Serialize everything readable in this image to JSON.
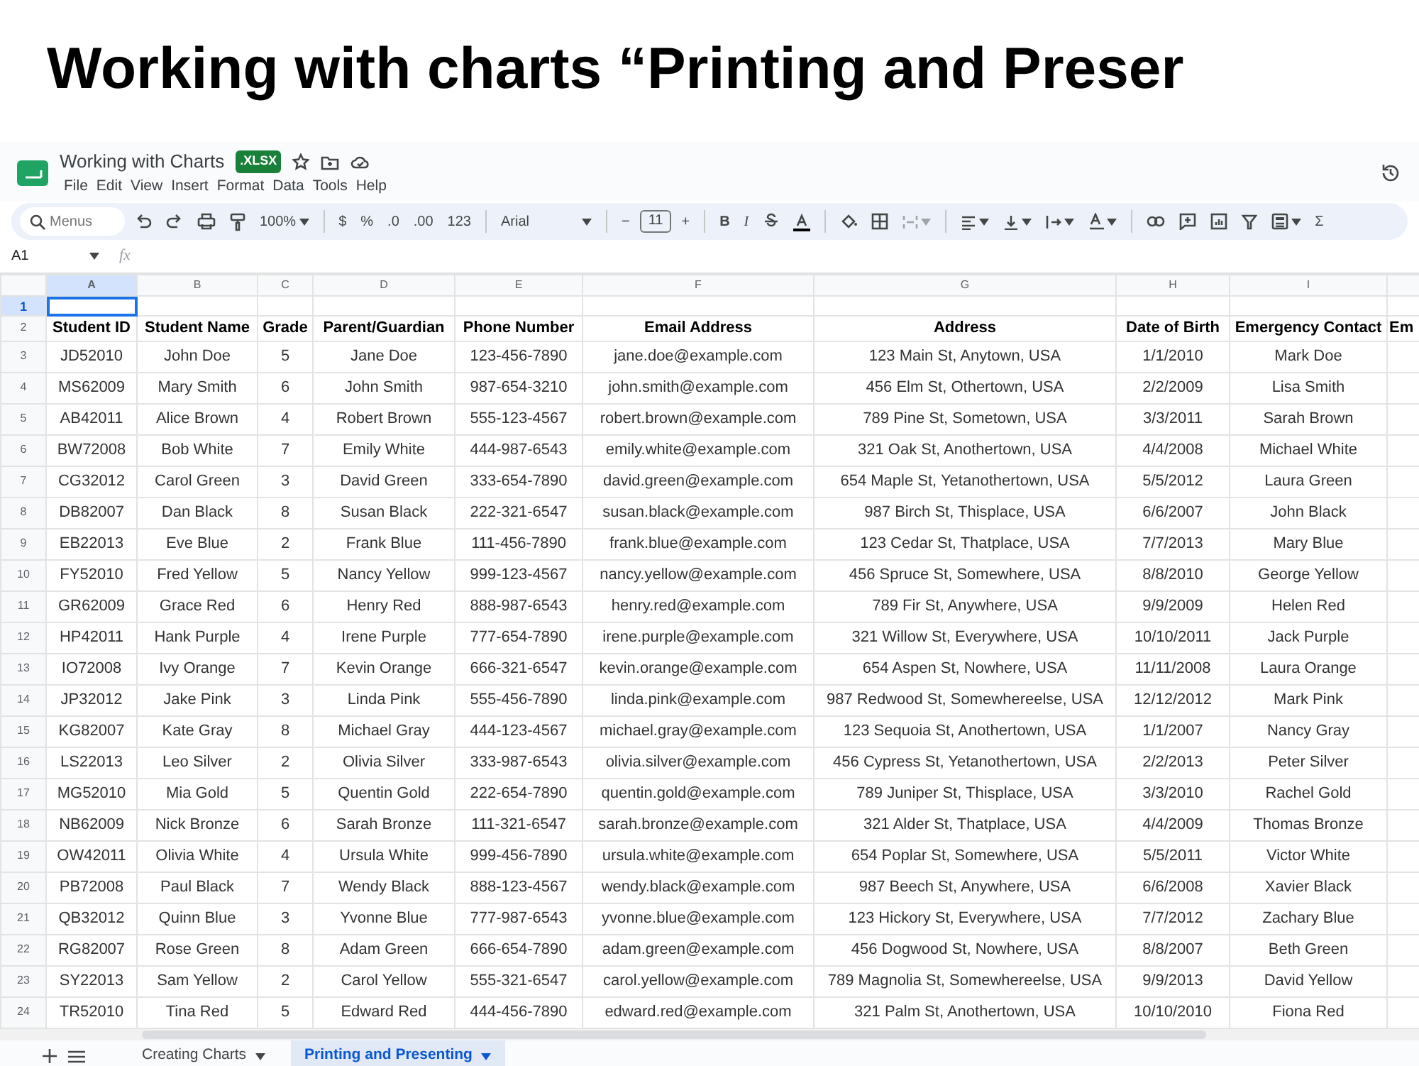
{
  "heading": "Working with charts “Printing and Preser",
  "doc": {
    "title": "Working with Charts",
    "badge": ".XLSX",
    "menus": [
      "File",
      "Edit",
      "View",
      "Insert",
      "Format",
      "Data",
      "Tools",
      "Help"
    ]
  },
  "toolbar": {
    "search_placeholder": "Menus",
    "zoom": "100%",
    "currency": "$",
    "percent": "%",
    "decrease_decimals": ".0",
    "increase_decimals": ".00",
    "number_format": "123",
    "font": "Arial",
    "minus": "−",
    "font_size": "11",
    "plus": "+",
    "bold": "B",
    "italic": "I",
    "sum": "Σ"
  },
  "name_box": "A1",
  "formula_label": "fx",
  "sheet": {
    "columns": [
      {
        "letter": "A",
        "selected": true
      },
      {
        "letter": "B",
        "selected": false
      },
      {
        "letter": "C",
        "selected": false
      },
      {
        "letter": "D",
        "selected": false
      },
      {
        "letter": "E",
        "selected": false
      },
      {
        "letter": "F",
        "selected": false
      },
      {
        "letter": "G",
        "selected": false
      },
      {
        "letter": "H",
        "selected": false
      },
      {
        "letter": "I",
        "selected": false
      }
    ],
    "rows": [
      {
        "num": "1",
        "selected": true
      },
      {
        "num": "2",
        "selected": false,
        "kind": "header",
        "cells": [
          "Student ID",
          "Student Name",
          "Grade",
          "Parent/Guardian",
          "Phone Number",
          "Email Address",
          "Address",
          "Date of Birth",
          "Emergency Contact",
          "Em"
        ]
      },
      {
        "num": "3",
        "selected": false,
        "cells": [
          "JD52010",
          "John Doe",
          "5",
          "Jane Doe",
          "123-456-7890",
          "jane.doe@example.com",
          "123 Main St, Anytown, USA",
          "1/1/2010",
          "Mark Doe"
        ]
      },
      {
        "num": "4",
        "selected": false,
        "cells": [
          "MS62009",
          "Mary Smith",
          "6",
          "John Smith",
          "987-654-3210",
          "john.smith@example.com",
          "456 Elm St, Othertown, USA",
          "2/2/2009",
          "Lisa Smith"
        ]
      },
      {
        "num": "5",
        "selected": false,
        "cells": [
          "AB42011",
          "Alice Brown",
          "4",
          "Robert Brown",
          "555-123-4567",
          "robert.brown@example.com",
          "789 Pine St, Sometown, USA",
          "3/3/2011",
          "Sarah Brown"
        ]
      },
      {
        "num": "6",
        "selected": false,
        "cells": [
          "BW72008",
          "Bob White",
          "7",
          "Emily White",
          "444-987-6543",
          "emily.white@example.com",
          "321 Oak St, Anothertown, USA",
          "4/4/2008",
          "Michael White"
        ]
      },
      {
        "num": "7",
        "selected": false,
        "cells": [
          "CG32012",
          "Carol Green",
          "3",
          "David Green",
          "333-654-7890",
          "david.green@example.com",
          "654 Maple St, Yetanothertown, USA",
          "5/5/2012",
          "Laura Green"
        ]
      },
      {
        "num": "8",
        "selected": false,
        "cells": [
          "DB82007",
          "Dan Black",
          "8",
          "Susan Black",
          "222-321-6547",
          "susan.black@example.com",
          "987 Birch St, Thisplace, USA",
          "6/6/2007",
          "John Black"
        ]
      },
      {
        "num": "9",
        "selected": false,
        "cells": [
          "EB22013",
          "Eve Blue",
          "2",
          "Frank Blue",
          "111-456-7890",
          "frank.blue@example.com",
          "123 Cedar St, Thatplace, USA",
          "7/7/2013",
          "Mary Blue"
        ]
      },
      {
        "num": "10",
        "selected": false,
        "cells": [
          "FY52010",
          "Fred Yellow",
          "5",
          "Nancy Yellow",
          "999-123-4567",
          "nancy.yellow@example.com",
          "456 Spruce St, Somewhere, USA",
          "8/8/2010",
          "George Yellow"
        ]
      },
      {
        "num": "11",
        "selected": false,
        "cells": [
          "GR62009",
          "Grace Red",
          "6",
          "Henry Red",
          "888-987-6543",
          "henry.red@example.com",
          "789 Fir St, Anywhere, USA",
          "9/9/2009",
          "Helen Red"
        ]
      },
      {
        "num": "12",
        "selected": false,
        "cells": [
          "HP42011",
          "Hank Purple",
          "4",
          "Irene Purple",
          "777-654-7890",
          "irene.purple@example.com",
          "321 Willow St, Everywhere, USA",
          "10/10/2011",
          "Jack Purple"
        ]
      },
      {
        "num": "13",
        "selected": false,
        "cells": [
          "IO72008",
          "Ivy Orange",
          "7",
          "Kevin Orange",
          "666-321-6547",
          "kevin.orange@example.com",
          "654 Aspen St, Nowhere, USA",
          "11/11/2008",
          "Laura Orange"
        ]
      },
      {
        "num": "14",
        "selected": false,
        "cells": [
          "JP32012",
          "Jake Pink",
          "3",
          "Linda Pink",
          "555-456-7890",
          "linda.pink@example.com",
          "987 Redwood St, Somewhereelse, USA",
          "12/12/2012",
          "Mark Pink"
        ]
      },
      {
        "num": "15",
        "selected": false,
        "cells": [
          "KG82007",
          "Kate Gray",
          "8",
          "Michael Gray",
          "444-123-4567",
          "michael.gray@example.com",
          "123 Sequoia St, Anothertown, USA",
          "1/1/2007",
          "Nancy Gray"
        ]
      },
      {
        "num": "16",
        "selected": false,
        "cells": [
          "LS22013",
          "Leo Silver",
          "2",
          "Olivia Silver",
          "333-987-6543",
          "olivia.silver@example.com",
          "456 Cypress St, Yetanothertown, USA",
          "2/2/2013",
          "Peter Silver"
        ]
      },
      {
        "num": "17",
        "selected": false,
        "cells": [
          "MG52010",
          "Mia Gold",
          "5",
          "Quentin Gold",
          "222-654-7890",
          "quentin.gold@example.com",
          "789 Juniper St, Thisplace, USA",
          "3/3/2010",
          "Rachel Gold"
        ]
      },
      {
        "num": "18",
        "selected": false,
        "cells": [
          "NB62009",
          "Nick Bronze",
          "6",
          "Sarah Bronze",
          "111-321-6547",
          "sarah.bronze@example.com",
          "321 Alder St, Thatplace, USA",
          "4/4/2009",
          "Thomas Bronze"
        ]
      },
      {
        "num": "19",
        "selected": false,
        "cells": [
          "OW42011",
          "Olivia White",
          "4",
          "Ursula White",
          "999-456-7890",
          "ursula.white@example.com",
          "654 Poplar St, Somewhere, USA",
          "5/5/2011",
          "Victor White"
        ]
      },
      {
        "num": "20",
        "selected": false,
        "cells": [
          "PB72008",
          "Paul Black",
          "7",
          "Wendy Black",
          "888-123-4567",
          "wendy.black@example.com",
          "987 Beech St, Anywhere, USA",
          "6/6/2008",
          "Xavier Black"
        ]
      },
      {
        "num": "21",
        "selected": false,
        "cells": [
          "QB32012",
          "Quinn Blue",
          "3",
          "Yvonne Blue",
          "777-987-6543",
          "yvonne.blue@example.com",
          "123 Hickory St, Everywhere, USA",
          "7/7/2012",
          "Zachary Blue"
        ]
      },
      {
        "num": "22",
        "selected": false,
        "cells": [
          "RG82007",
          "Rose Green",
          "8",
          "Adam Green",
          "666-654-7890",
          "adam.green@example.com",
          "456 Dogwood St, Nowhere, USA",
          "8/8/2007",
          "Beth Green"
        ]
      },
      {
        "num": "23",
        "selected": false,
        "cells": [
          "SY22013",
          "Sam Yellow",
          "2",
          "Carol Yellow",
          "555-321-6547",
          "carol.yellow@example.com",
          "789 Magnolia St, Somewhereelse, USA",
          "9/9/2013",
          "David Yellow"
        ]
      },
      {
        "num": "24",
        "selected": false,
        "cells": [
          "TR52010",
          "Tina Red",
          "5",
          "Edward Red",
          "444-456-7890",
          "edward.red@example.com",
          "321 Palm St, Anothertown, USA",
          "10/10/2010",
          "Fiona Red"
        ]
      }
    ]
  },
  "sheet_tabs": [
    {
      "label": "Creating Charts",
      "selected": false
    },
    {
      "label": "Printing and Presenting",
      "selected": true
    }
  ]
}
